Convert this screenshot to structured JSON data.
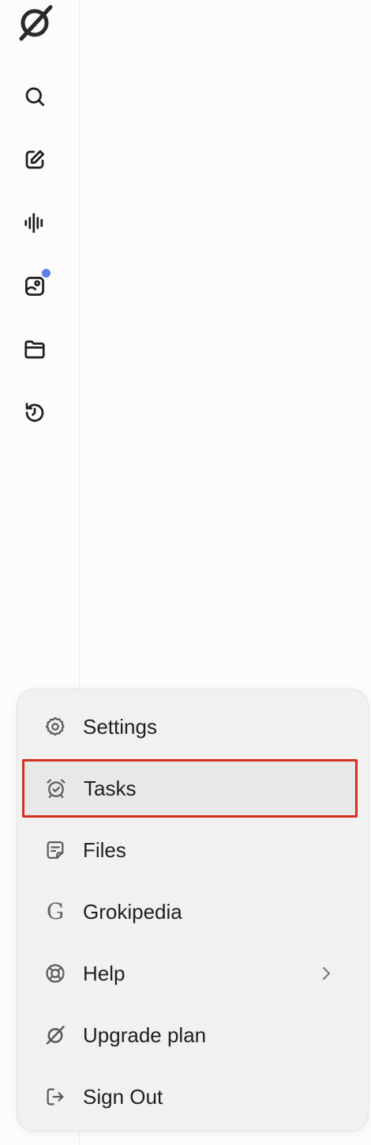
{
  "sidebar": {
    "logo": "grok-logo",
    "items": [
      {
        "icon": "search-icon",
        "has_badge": false
      },
      {
        "icon": "new-chat-icon",
        "has_badge": false
      },
      {
        "icon": "voice-icon",
        "has_badge": false
      },
      {
        "icon": "imagine-icon",
        "has_badge": true
      },
      {
        "icon": "projects-folder-icon",
        "has_badge": false
      },
      {
        "icon": "history-icon",
        "has_badge": false
      }
    ],
    "badge_color": "#5b7ff0"
  },
  "menu": {
    "items": [
      {
        "label": "Settings",
        "icon": "gear-icon"
      },
      {
        "label": "Tasks",
        "icon": "alarm-clock-icon",
        "highlighted": true
      },
      {
        "label": "Files",
        "icon": "file-icon"
      },
      {
        "label": "Grokipedia",
        "icon": "grokipedia-g-icon"
      },
      {
        "label": "Help",
        "icon": "lifebuoy-icon",
        "has_submenu": true
      },
      {
        "label": "Upgrade plan",
        "icon": "grok-logo-icon"
      },
      {
        "label": "Sign Out",
        "icon": "sign-out-icon"
      }
    ],
    "grokipedia_glyph": "G",
    "highlight_color": "#d3311f"
  }
}
